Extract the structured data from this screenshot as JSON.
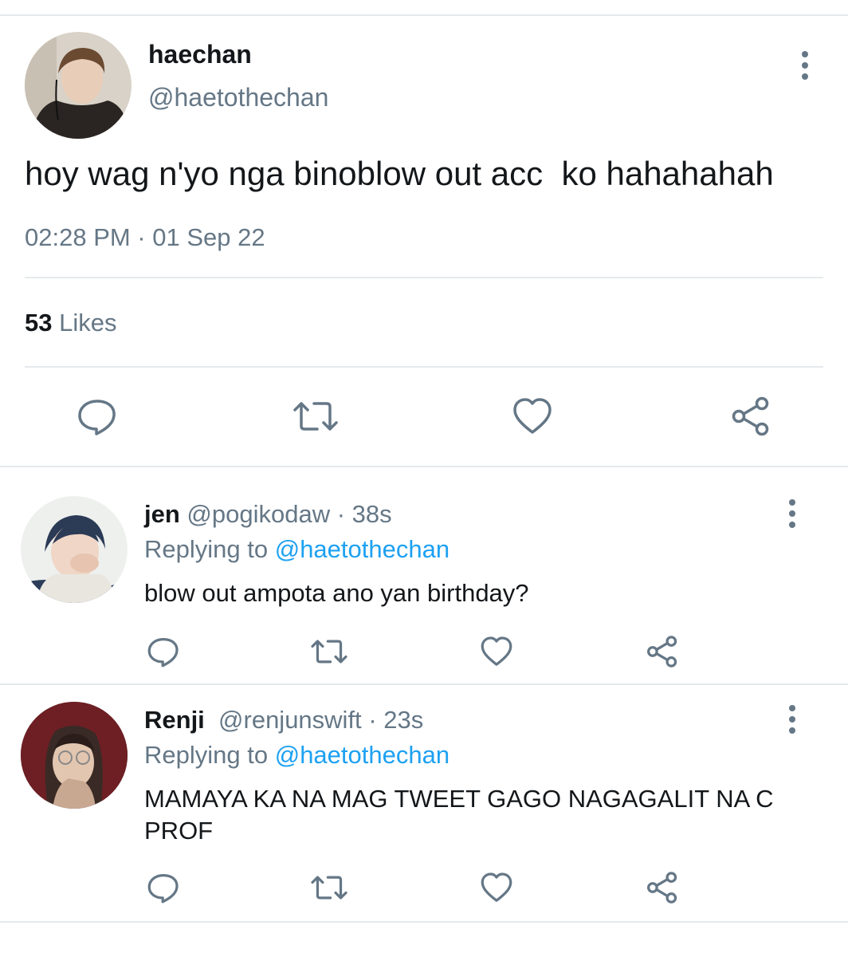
{
  "main_tweet": {
    "name": "haechan",
    "handle": "@haetothechan",
    "text": "hoy wag n'yo nga binoblow out acc  ko hahahahah",
    "timestamp": "02:28 PM · 01 Sep 22",
    "likes_count": "53",
    "likes_label": "Likes"
  },
  "replies": [
    {
      "name": "jen",
      "handle": "@pogikodaw",
      "time": "· 38s",
      "replying_prefix": "Replying to",
      "replying_to": "@haetothechan",
      "text": "blow out ampota ano yan birthday?"
    },
    {
      "name": "Renji",
      "handle": "@renjunswift",
      "time": "· 23s",
      "replying_prefix": "Replying to",
      "replying_to": "@haetothechan",
      "text": "MAMAYA KA NA MAG TWEET GAGO NAGAGALIT NA C PROF"
    }
  ],
  "icons": {
    "reply": "speech-bubble-icon",
    "retweet": "retweet-icon",
    "like": "heart-icon",
    "share": "share-icon",
    "more": "vertical-dots-icon"
  },
  "colors": {
    "text": "#14171a",
    "secondary": "#657786",
    "link": "#1da1f2",
    "divider": "#e6e9ec"
  }
}
